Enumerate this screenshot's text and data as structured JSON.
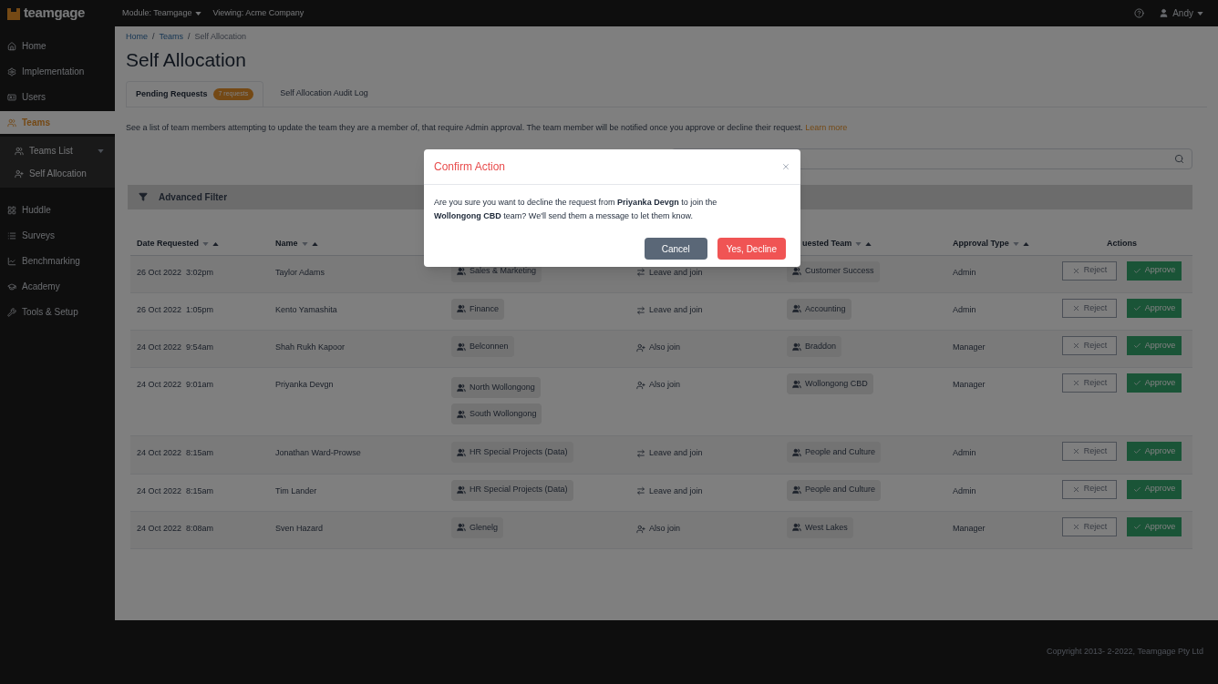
{
  "topbar": {
    "logo": "teamgage",
    "module": "Module: Teamgage",
    "viewing": "Viewing: Acme Company",
    "user": "Andy"
  },
  "sidebar": {
    "items": [
      {
        "label": "Home",
        "selected": false
      },
      {
        "label": "Implementation",
        "selected": false
      },
      {
        "label": "Users",
        "selected": false
      },
      {
        "label": "Teams",
        "selected": true,
        "children": [
          {
            "label": "Teams List",
            "caret": true,
            "selected": false
          },
          {
            "label": "Self Allocation",
            "selected": false
          }
        ]
      },
      {
        "label": "Huddle",
        "selected": false
      },
      {
        "label": "Surveys",
        "selected": false
      },
      {
        "label": "Benchmarking",
        "selected": false
      },
      {
        "label": "Academy",
        "selected": false
      },
      {
        "label": "Tools & Setup",
        "selected": false
      }
    ]
  },
  "breadcrumb": [
    {
      "kind": "link",
      "label": "Home"
    },
    {
      "kind": "separator",
      "label": "/"
    },
    {
      "kind": "link",
      "label": "Teams"
    },
    {
      "kind": "separator",
      "label": "/"
    },
    {
      "kind": "current",
      "label": "Self Allocation"
    }
  ],
  "page_title": "Self Allocation",
  "tabs": [
    {
      "label": "Pending Requests",
      "badge": "7 requests",
      "selected": true
    },
    {
      "label": "Self Allocation Audit Log",
      "selected": false
    }
  ],
  "description": "See a list of team members attempting to update the team they are a member of, that require Admin approval. The team member will be notified once you approve or decline their request.",
  "learn_more": "Learn more",
  "filter": {
    "label": "Advanced Filter"
  },
  "table": {
    "columns": [
      {
        "kind": "text",
        "label": "Date Requested",
        "sortable": true
      },
      {
        "kind": "text",
        "label": "Name",
        "sortable": true
      },
      {
        "kind": "covered"
      },
      {
        "kind": "covered"
      },
      {
        "kind": "text",
        "label": "uested Team",
        "sortable": true
      },
      {
        "kind": "text",
        "label": "Approval Type",
        "sortable": true
      },
      {
        "kind": "text",
        "label": "Actions",
        "sortable": false
      }
    ],
    "rows": [
      {
        "date": "26 Oct 2022  3:02pm",
        "name": "Taylor Adams",
        "current_teams": [
          "Sales & Marketing"
        ],
        "change": {
          "kind": "leave",
          "label": "Leave and join"
        },
        "requested_team": "Customer Success",
        "approval_type": "Admin",
        "actions": [
          "Reject",
          "Approve"
        ]
      },
      {
        "date": "26 Oct 2022  1:05pm",
        "name": "Kento Yamashita",
        "current_teams": [
          "Finance"
        ],
        "change": {
          "kind": "leave",
          "label": "Leave and join"
        },
        "requested_team": "Accounting",
        "approval_type": "Admin",
        "actions": [
          "Reject",
          "Approve"
        ]
      },
      {
        "date": "24 Oct 2022  9:54am",
        "name": "Shah Rukh Kapoor",
        "current_teams": [
          "Belconnen"
        ],
        "change": {
          "kind": "also",
          "label": "Also join"
        },
        "requested_team": "Braddon",
        "approval_type": "Manager",
        "actions": [
          "Reject",
          "Approve"
        ]
      },
      {
        "date": "24 Oct 2022  9:01am",
        "name": "Priyanka Devgn",
        "current_teams": [
          "North Wollongong",
          "South Wollongong"
        ],
        "change": {
          "kind": "also",
          "label": "Also join"
        },
        "requested_team": "Wollongong CBD",
        "approval_type": "Manager",
        "actions": [
          "Reject",
          "Approve"
        ]
      },
      {
        "date": "24 Oct 2022  8:15am",
        "name": "Jonathan Ward-Prowse",
        "current_teams": [
          "HR Special Projects (Data)"
        ],
        "change": {
          "kind": "leave",
          "label": "Leave and join"
        },
        "requested_team": "People and Culture",
        "approval_type": "Admin",
        "actions": [
          "Reject",
          "Approve"
        ]
      },
      {
        "date": "24 Oct 2022  8:15am",
        "name": "Tim Lander",
        "current_teams": [
          "HR Special Projects (Data)"
        ],
        "change": {
          "kind": "leave",
          "label": "Leave and join"
        },
        "requested_team": "People and Culture",
        "approval_type": "Admin",
        "actions": [
          "Reject",
          "Approve"
        ]
      },
      {
        "date": "24 Oct 2022  8:08am",
        "name": "Sven Hazard",
        "current_teams": [
          "Glenelg"
        ],
        "change": {
          "kind": "also",
          "label": "Also join"
        },
        "requested_team": "West Lakes",
        "approval_type": "Manager",
        "actions": [
          "Reject",
          "Approve"
        ]
      }
    ]
  },
  "footer": "Copyright 2013- 2-2022, Teamgage Pty Ltd",
  "modal": {
    "title": "Confirm Action",
    "message": "Are you sure you want to decline the request from **Priyanka Devgn** to join the **Wollongong CBD** team? We'll send them a message to let them know.",
    "buttons": [
      {
        "label": "Cancel",
        "kind": "secondary"
      },
      {
        "label": "Yes, Decline",
        "kind": "danger"
      }
    ]
  }
}
